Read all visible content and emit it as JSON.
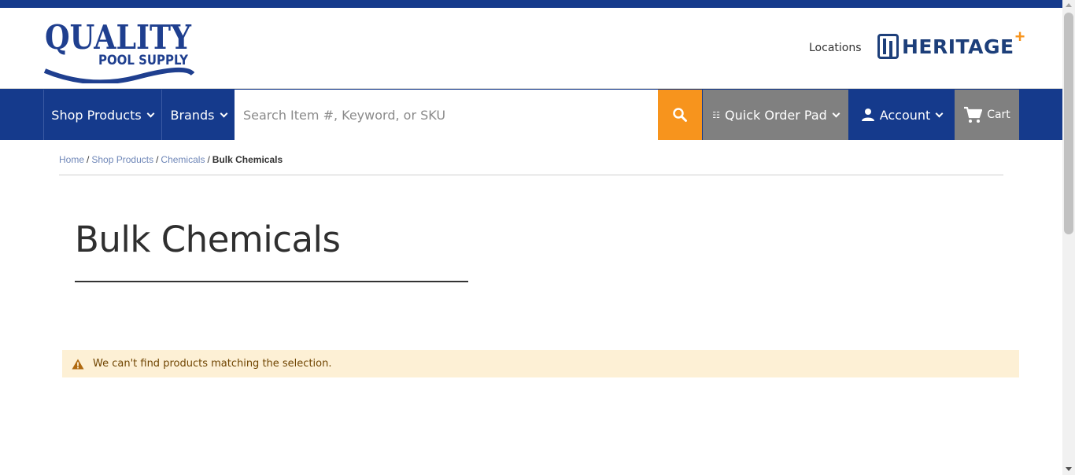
{
  "header": {
    "logo_line1": "QUALITY",
    "logo_line2": "POOL SUPPLY",
    "locations_label": "Locations",
    "partner_logo_text": "HERITAGE",
    "partner_logo_mark": "+"
  },
  "nav": {
    "shop_products_label": "Shop Products",
    "brands_label": "Brands",
    "search_placeholder": "Search Item #, Keyword, or SKU",
    "search_value": "",
    "quick_order_label": "Quick Order Pad",
    "account_label": "Account",
    "cart_label": "Cart"
  },
  "breadcrumb": {
    "items": [
      "Home",
      "Shop Products",
      "Chemicals"
    ],
    "separator": "/",
    "current": "Bulk Chemicals"
  },
  "page": {
    "title": "Bulk Chemicals"
  },
  "notice": {
    "message": "We can't find products matching the selection."
  },
  "colors": {
    "brand_blue": "#153a8c",
    "accent_orange": "#f7941d",
    "nav_gray": "#808080",
    "notice_bg": "#fdf0d5",
    "notice_text": "#6f4400"
  },
  "icons": {
    "search": "search-icon",
    "account": "user-icon",
    "cart": "cart-icon",
    "warning": "warning-icon",
    "quick_order": "list-icon",
    "dropdown": "chevron-down-icon"
  }
}
